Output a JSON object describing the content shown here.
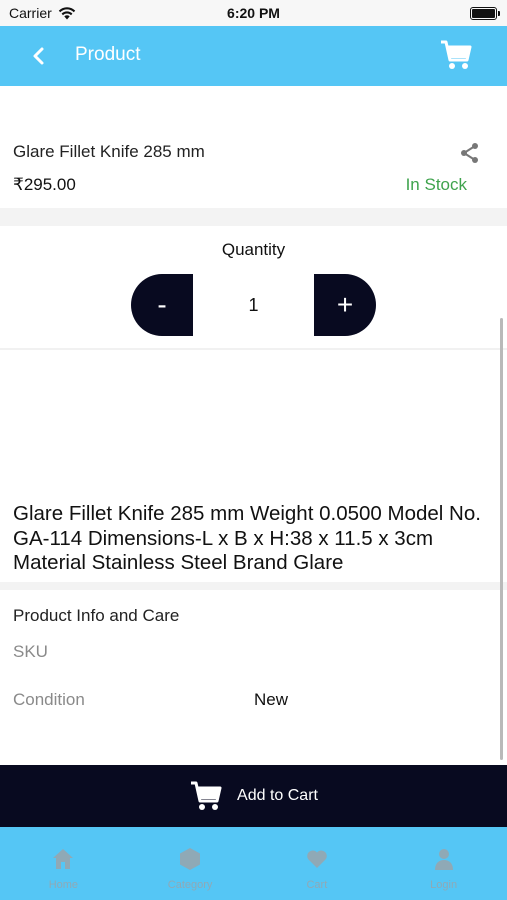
{
  "status_bar": {
    "carrier": "Carrier",
    "time": "6:20 PM"
  },
  "nav": {
    "title": "Product",
    "back_icon": "chevron-left-icon",
    "cart_icon": "cart-icon"
  },
  "product": {
    "name": "Glare Fillet Knife 285 mm",
    "price": "₹295.00",
    "stock": "In Stock"
  },
  "quantity": {
    "label": "Quantity",
    "minus": "-",
    "plus": "+",
    "value": "1"
  },
  "description": "Glare Fillet Knife 285 mm Weight 0.0500 Model No. GA-114 Dimensions-L x B x H:38 x 11.5 x 3cm Material Stainless Steel Brand Glare",
  "info": {
    "title": "Product Info and Care",
    "sku_label": "SKU",
    "sku_value": "",
    "condition_label": "Condition",
    "condition_value": "New"
  },
  "add_to_cart": {
    "label": "Add to Cart"
  },
  "tabs": [
    {
      "label": "Home",
      "icon": "home-icon"
    },
    {
      "label": "Category",
      "icon": "category-icon"
    },
    {
      "label": "Cart",
      "icon": "heart-icon"
    },
    {
      "label": "Login",
      "icon": "user-icon"
    }
  ],
  "colors": {
    "accent": "#55c6f5",
    "dark": "#080a20",
    "in_stock": "#3fa34d"
  }
}
